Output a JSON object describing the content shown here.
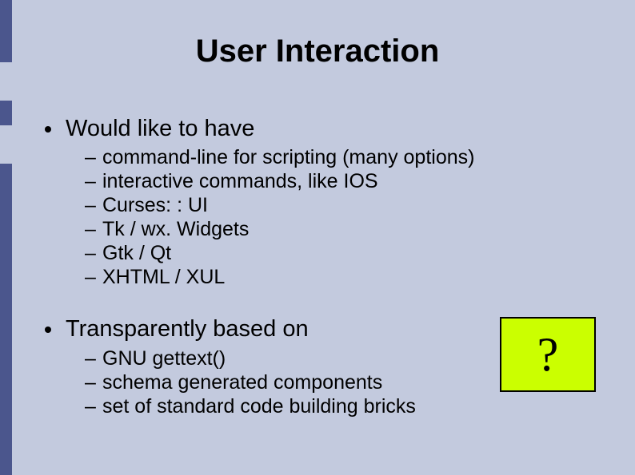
{
  "title": "User Interaction",
  "bullets": [
    {
      "text": "Would like to have",
      "sub": [
        "command-line for scripting (many options)",
        "interactive commands, like IOS",
        "Curses: : UI",
        "Tk / wx. Widgets",
        "Gtk / Qt",
        "XHTML / XUL"
      ]
    },
    {
      "text": "Transparently based on",
      "sub": [
        "GNU gettext()",
        "schema generated components",
        "set of standard code building bricks"
      ]
    }
  ],
  "question_mark": "?",
  "colors": {
    "background": "#c3cade",
    "rail": "#4b568d",
    "box_fill": "#cbff00"
  }
}
